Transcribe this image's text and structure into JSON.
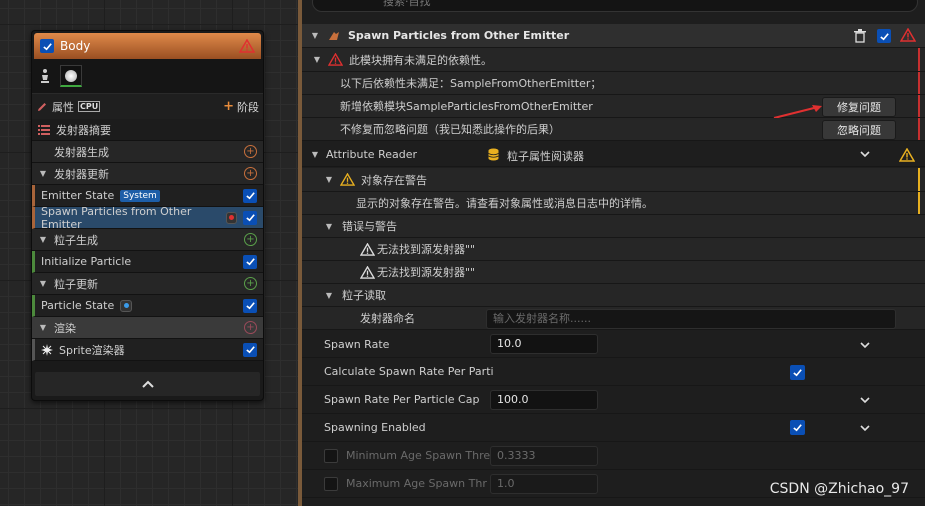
{
  "node": {
    "title": "Body",
    "tabs": {
      "properties": "属性",
      "cpu_tag": "CPU",
      "stage": "阶段"
    },
    "rows": [
      {
        "label": "发射器摘要"
      },
      {
        "label": "发射器生成"
      },
      {
        "label": "发射器更新"
      },
      {
        "label": "Emitter State",
        "tag": "System"
      },
      {
        "label": "Spawn Particles from Other Emitter"
      },
      {
        "label": "粒子生成"
      },
      {
        "label": "Initialize Particle"
      },
      {
        "label": "粒子更新"
      },
      {
        "label": "Particle State"
      },
      {
        "label": "渲染"
      },
      {
        "label": "Sprite渲染器"
      }
    ]
  },
  "panel": {
    "search_placeholder": "搜索·自找",
    "module_title": "Spawn Particles from Other Emitter",
    "dependency_warning": "此模块拥有未满足的依赖性。",
    "unmet_line": "以下后依赖性未满足：SampleFromOtherEmitter；",
    "add_module_line": "新增依赖模块SampleParticlesFromOtherEmitter",
    "ignore_line": "不修复而忽略问题（我已知悉此操作的后果）",
    "fix_button": "修复问题",
    "ignore_button": "忽略问题",
    "attribute_reader": {
      "label": "Attribute Reader",
      "value": "粒子属性阅读器"
    },
    "object_warning_title": "对象存在警告",
    "object_warning_text": "显示的对象存在警告。请查看对象属性或消息日志中的详情。",
    "errors_title": "错误与警告",
    "error_1": "无法找到源发射器\"\"",
    "error_2": "无法找到源发射器\"\"",
    "particle_read": "粒子读取",
    "emitter_name_label": "发射器命名",
    "emitter_name_placeholder": "输入发射器名称......",
    "props": {
      "spawn_rate": {
        "label": "Spawn Rate",
        "value": "10.0"
      },
      "calc_spawn_rate": {
        "label": "Calculate Spawn Rate Per Parti",
        "checked": true
      },
      "spawn_rate_cap": {
        "label": "Spawn Rate Per Particle Cap",
        "value": "100.0"
      },
      "spawning_enabled": {
        "label": "Spawning Enabled",
        "checked": true
      },
      "min_age": {
        "label": "Minimum Age Spawn Thre",
        "value": "0.3333"
      },
      "max_age": {
        "label": "Maximum Age Spawn Thr",
        "value": "1.0"
      }
    }
  },
  "watermark": "CSDN @Zhichao_97",
  "colors": {
    "accent_blue": "#0a4fb5",
    "warning_red": "#e03030",
    "warning_yellow": "#e8b020",
    "node_header": "#c8703c"
  }
}
